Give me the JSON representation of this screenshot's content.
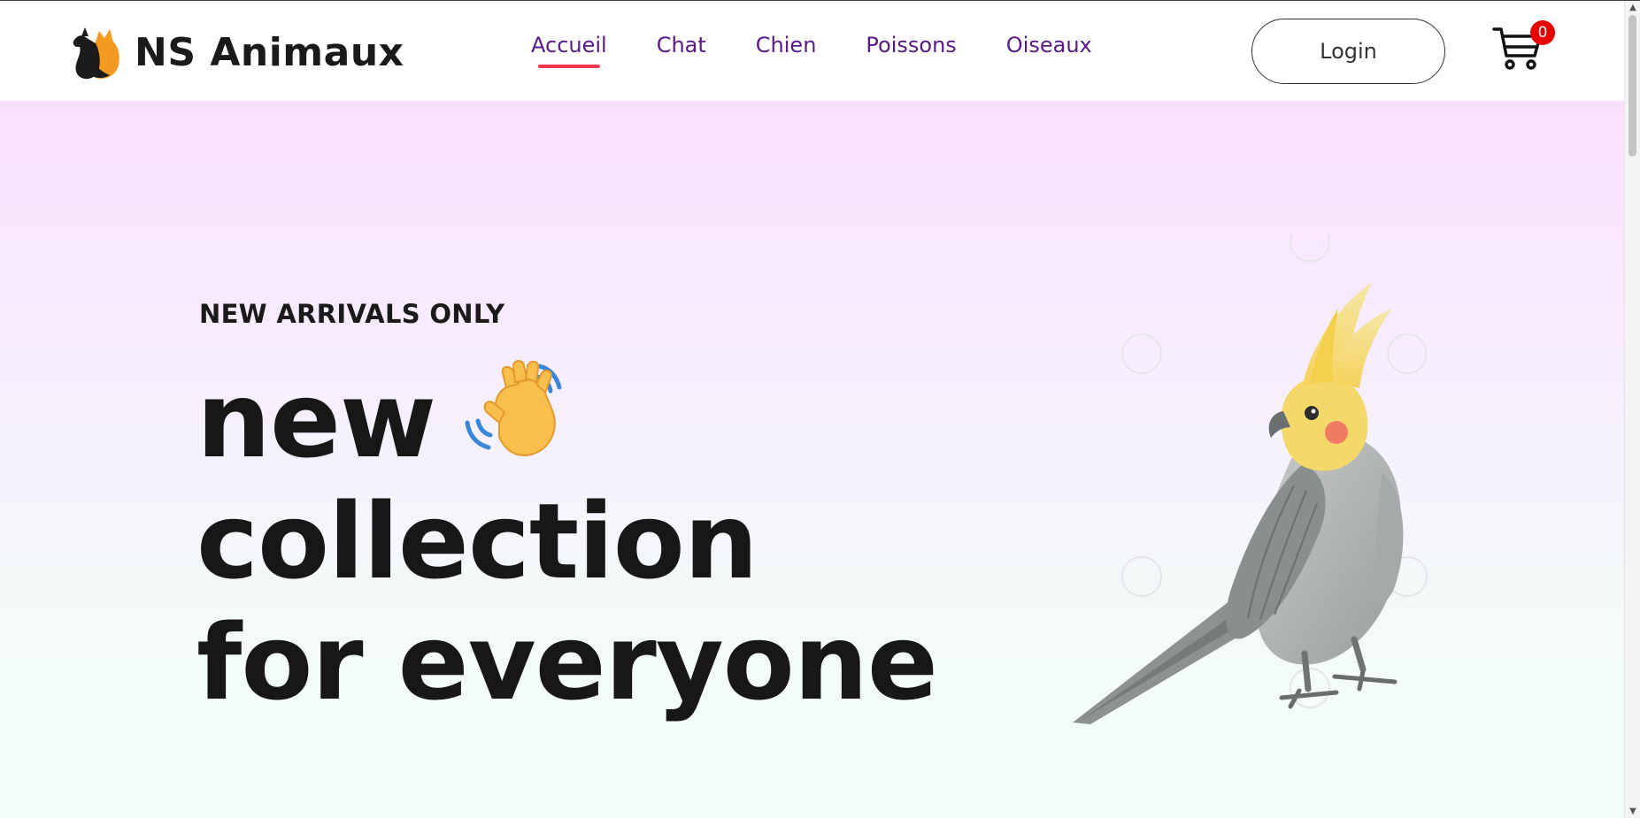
{
  "brand": {
    "name": "NS Animaux",
    "logo_icon": "cat-dog-silhouette-icon"
  },
  "nav": {
    "links": [
      {
        "label": "Accueil",
        "active": true
      },
      {
        "label": "Chat",
        "active": false
      },
      {
        "label": "Chien",
        "active": false
      },
      {
        "label": "Poissons",
        "active": false
      },
      {
        "label": "Oiseaux",
        "active": false
      }
    ],
    "active_color": "#ee3b4e",
    "link_color": "#5a1a86"
  },
  "header": {
    "login_label": "Login",
    "cart_icon": "shopping-cart-icon",
    "cart_count": "0",
    "badge_color": "#e80000"
  },
  "hero": {
    "tag": "NEW ARRIVALS ONLY",
    "title_line1": "new",
    "title_line2": "collection",
    "title_line3": "for everyone",
    "wave_icon": "waving-hand-icon",
    "image_icon": "cockatiel-bird-illustration",
    "gradient_top": "#fae0fc",
    "gradient_bottom": "#f1fff8"
  }
}
